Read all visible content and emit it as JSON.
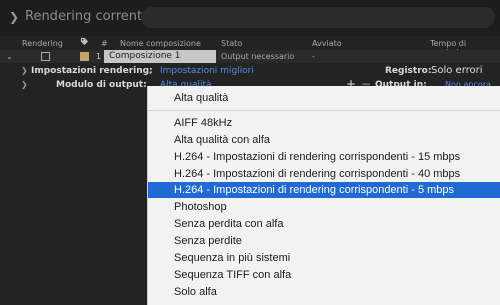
{
  "panel": {
    "title": "Rendering corrente"
  },
  "columns": {
    "rendering": "Rendering",
    "hash": "#",
    "name": "Nome composizione",
    "state": "Stato",
    "started": "Avviato",
    "render_time": "Tempo di rendering"
  },
  "queue_item": {
    "index": "1",
    "name": "Composizione 1",
    "state": "Output necessario",
    "started": "-"
  },
  "render_settings": {
    "label": "Impostazioni rendering:",
    "value": "Impostazioni migliori",
    "log_label": "Registro:",
    "log_value": "Solo errori"
  },
  "output_module": {
    "label": "Modulo di output:",
    "value": "Alta qualità",
    "output_to_label": "Output in:",
    "output_to_value": "Non ancora sp"
  },
  "dropdown": {
    "selected_index": 6,
    "items": [
      "Alta qualità",
      "AIFF 48kHz",
      "Alta qualità con alfa",
      "H.264 - Impostazioni di rendering corrispondenti - 15 mbps",
      "H.264 - Impostazioni di rendering corrispondenti - 40 mbps",
      "H.264 - Impostazioni di rendering corrispondenti - 5 mbps",
      "Photoshop",
      "Senza perdita con alfa",
      "Senza perdite",
      "Sequenza in più sistemi",
      "Sequenza TIFF con alfa",
      "Solo alfa"
    ]
  },
  "colors": {
    "accent": "#1f6ad3",
    "link": "#4e90e6",
    "label_swatch": "#c6a36a",
    "panel_bg": "#232323"
  }
}
